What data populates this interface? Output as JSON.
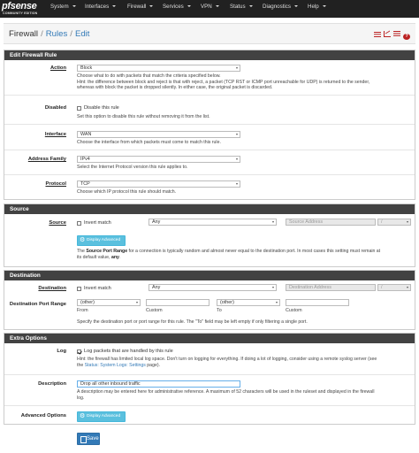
{
  "nav": {
    "logo_main": "pfsense",
    "logo_sub": "COMMUNITY EDITION",
    "items": [
      "System",
      "Interfaces",
      "Firewall",
      "Services",
      "VPN",
      "Status",
      "Diagnostics",
      "Help"
    ]
  },
  "breadcrumb": {
    "root": "Firewall",
    "sep": "/",
    "middle": "Rules",
    "current": "Edit"
  },
  "edit_rule": {
    "heading": "Edit Firewall Rule",
    "action_label": "Action",
    "action_value": "Block",
    "action_hint_1": "Choose what to do with packets that match the criteria specified below.",
    "action_hint_2": "Hint: the difference between block and reject is that with reject, a packet (TCP RST or ICMP port unreachable for UDP) is returned to the sender,",
    "action_hint_3": "whereas with block the packet is dropped silently. In either case, the original packet is discarded.",
    "disabled_label": "Disabled",
    "disabled_check": "Disable this rule",
    "disabled_hint": "Set this option to disable this rule without removing it from the list.",
    "interface_label": "Interface",
    "interface_value": "WAN",
    "interface_hint": "Choose the interface from which packets must come to match this rule.",
    "family_label": "Address Family",
    "family_value": "IPv4",
    "family_hint": "Select the Internet Protocol version this rule applies to.",
    "protocol_label": "Protocol",
    "protocol_value": "TCP",
    "protocol_hint": "Choose which IP protocol this rule should match."
  },
  "source": {
    "heading": "Source",
    "label": "Source",
    "invert": "Invert match",
    "type": "Any",
    "address_placeholder": "Source Address",
    "slash": "/",
    "adv_button": "Display Advanced",
    "hint_pre": "The ",
    "hint_bold": "Source Port Range",
    "hint_post": " for a connection is typically random and almost never equal to the destination port. In most cases this setting must remain at",
    "hint_2_pre": "its default value, ",
    "hint_2_bold": "any",
    "hint_2_post": "."
  },
  "destination": {
    "heading": "Destination",
    "label": "Destination",
    "invert": "Invert match",
    "type": "Any",
    "address_placeholder": "Destination Address",
    "slash": "/",
    "range_label": "Destination Port Range",
    "from_value": "(other)",
    "to_value": "(other)",
    "from_label": "From",
    "custom_label": "Custom",
    "to_label": "To",
    "custom_label_2": "Custom",
    "hint": "Specify the destination port or port range for this rule. The \"To\" field may be left empty if only filtering a single port."
  },
  "extra": {
    "heading": "Extra Options",
    "log_label": "Log",
    "log_check": "Log packets that are handled by this rule",
    "log_hint_1": "Hint: the firewall has limited local log space. Don't turn on logging for everything. If doing a lot of logging, consider using a remote syslog server (see",
    "log_hint_2_pre": "the ",
    "log_hint_2_link": "Status: System Logs: Settings",
    "log_hint_2_post": " page).",
    "desc_label": "Description",
    "desc_value": "Drop all other inbound traffic",
    "desc_hint_1": "A description may be entered here for administrative reference. A maximum of 52 characters will be used in the ruleset and displayed in the firewall",
    "desc_hint_2": "log.",
    "adv_label": "Advanced Options",
    "adv_button": "Display Advanced"
  },
  "save_button": "Save",
  "colors": {
    "navbar": "#212121",
    "panel_heading": "#424242",
    "link": "#337ab7",
    "info_button": "#5bc0de",
    "primary_button": "#337ab7",
    "icon_red": "#b22222"
  }
}
